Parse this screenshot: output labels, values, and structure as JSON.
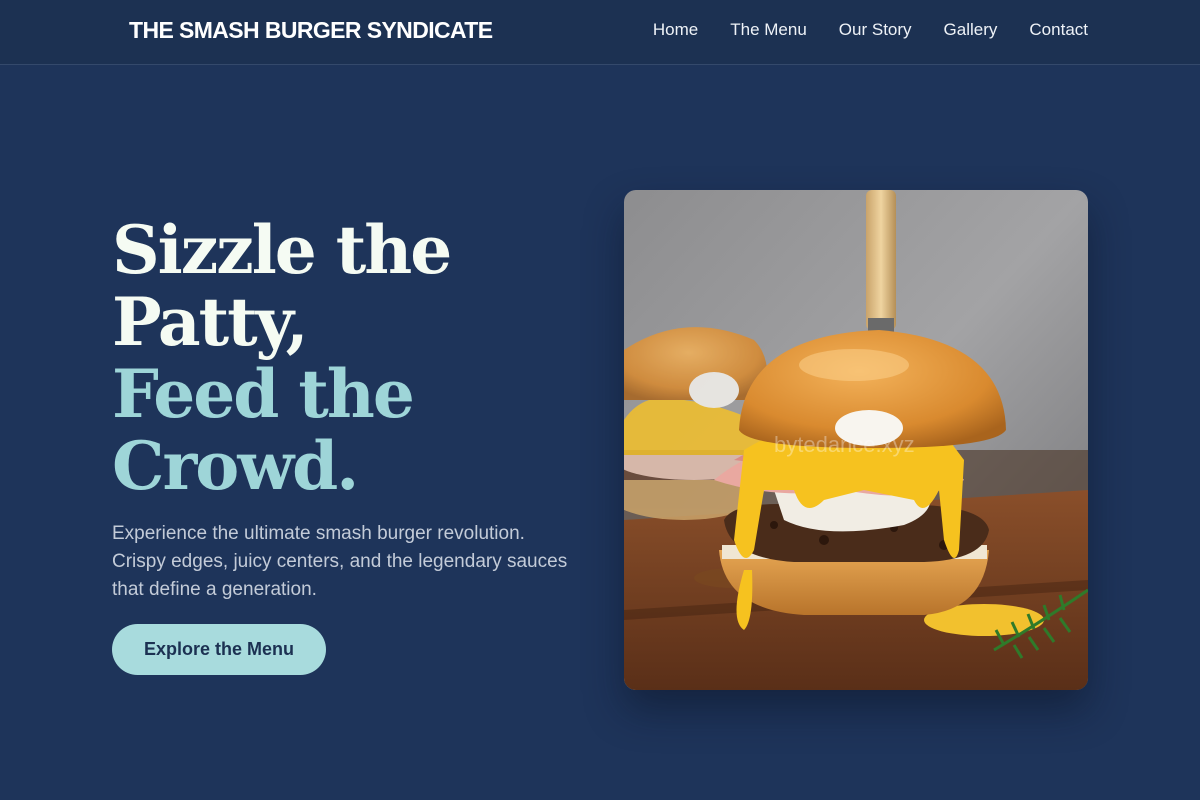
{
  "header": {
    "brand": "THE SMASH BURGER SYNDICATE",
    "nav": [
      "Home",
      "The Menu",
      "Our Story",
      "Gallery",
      "Contact"
    ]
  },
  "hero": {
    "headline_white": [
      "Sizzle the",
      "Patty,"
    ],
    "headline_teal": [
      "Feed the",
      "Crowd."
    ],
    "subtitle": "Experience the ultimate smash burger revolution. Crispy edges, juicy centers, and the legendary sauces that define a generation.",
    "cta_label": "Explore the Menu"
  },
  "image": {
    "subject": "burger-photo",
    "watermark": "bytedance.xyz"
  },
  "colors": {
    "background": "#1e345a",
    "header": "#1c3152",
    "accent_teal": "#9ed5d8",
    "button": "#a8dbdd",
    "headline_white": "#f5fbf3"
  }
}
